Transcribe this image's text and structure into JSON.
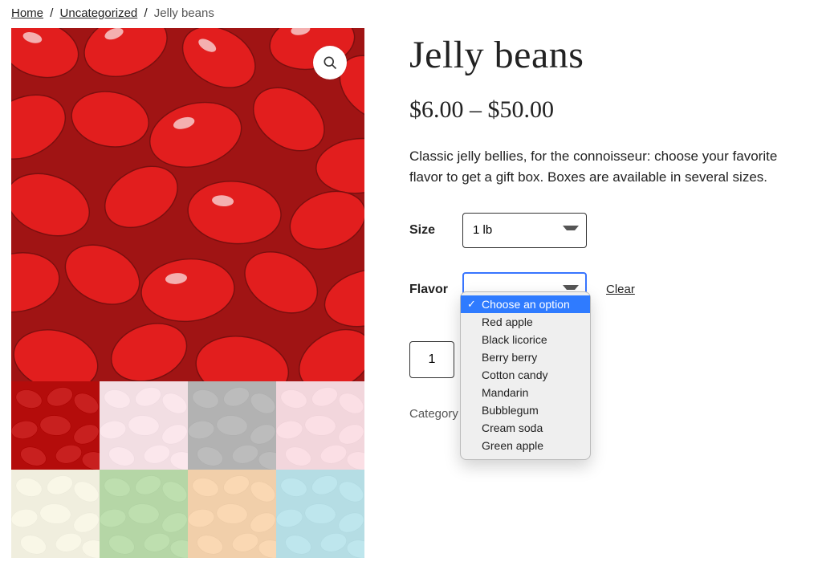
{
  "breadcrumb": {
    "home": "Home",
    "category": "Uncategorized",
    "current": "Jelly beans"
  },
  "product": {
    "title": "Jelly beans",
    "price_low": "$6.00",
    "price_sep": "–",
    "price_high": "$50.00",
    "description": "Classic jelly bellies, for the connoisseur: choose your favorite flavor to get a gift box. Boxes are available in several sizes.",
    "size_label": "Size",
    "size_value": "1 lb",
    "flavor_label": "Flavor",
    "flavor_placeholder": "Choose an option",
    "flavor_options": [
      "Red apple",
      "Black licorice",
      "Berry berry",
      "Cotton candy",
      "Mandarin",
      "Bubblegum",
      "Cream soda",
      "Green apple"
    ],
    "clear_label": "Clear",
    "quantity": "1",
    "category_prefix": "Category"
  },
  "thumbnails": [
    {
      "color": "#c8201f",
      "active": true
    },
    {
      "color": "#f6c9d6",
      "active": false
    },
    {
      "color": "#6a6a6a",
      "active": false
    },
    {
      "color": "#f7b8c6",
      "active": false
    },
    {
      "color": "#f2eecb",
      "active": false
    },
    {
      "color": "#6fb84f",
      "active": false
    },
    {
      "color": "#f3a857",
      "active": false
    },
    {
      "color": "#6fc8d8",
      "active": false
    }
  ]
}
